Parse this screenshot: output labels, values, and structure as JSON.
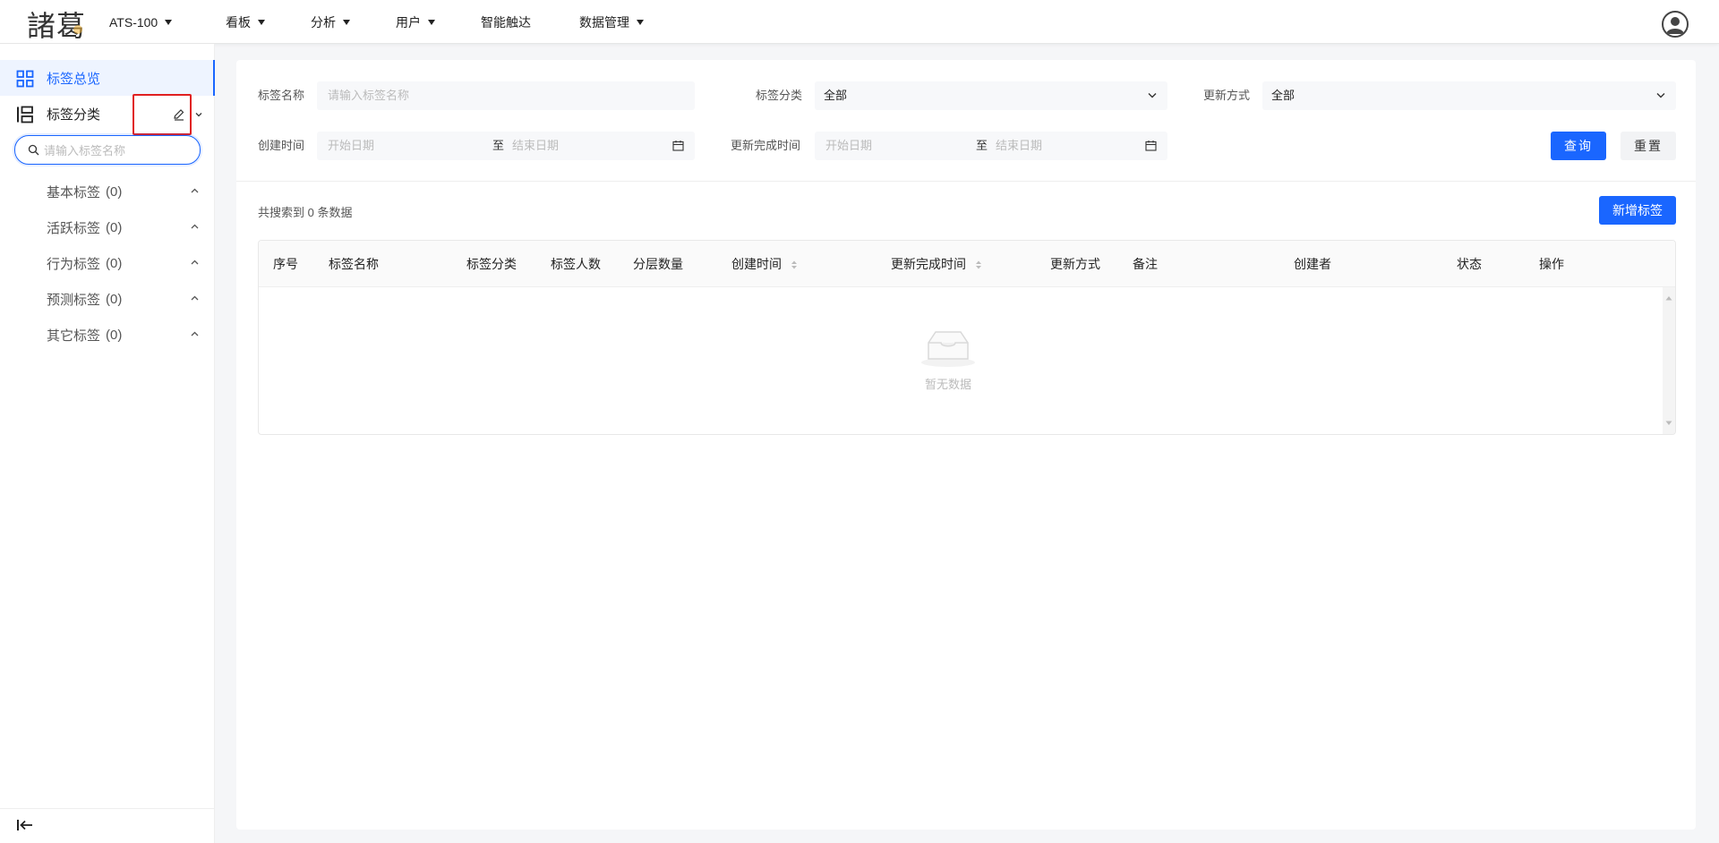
{
  "logo": {
    "text": "諸葛"
  },
  "topnav": [
    {
      "label": "ATS-100",
      "dropdown": true
    },
    {
      "label": "看板",
      "dropdown": true
    },
    {
      "label": "分析",
      "dropdown": true
    },
    {
      "label": "用户",
      "dropdown": true
    },
    {
      "label": "智能触达",
      "dropdown": false
    },
    {
      "label": "数据管理",
      "dropdown": true
    }
  ],
  "sidebar": {
    "overview_label": "标签总览",
    "category_label": "标签分类",
    "search_placeholder": "请输入标签名称",
    "tree": [
      {
        "label": "基本标签",
        "count": "(0)"
      },
      {
        "label": "活跃标签",
        "count": "(0)"
      },
      {
        "label": "行为标签",
        "count": "(0)"
      },
      {
        "label": "预测标签",
        "count": "(0)"
      },
      {
        "label": "其它标签",
        "count": "(0)"
      }
    ]
  },
  "filters": {
    "name_label": "标签名称",
    "name_placeholder": "请输入标签名称",
    "category_label": "标签分类",
    "category_value": "全部",
    "update_mode_label": "更新方式",
    "update_mode_value": "全部",
    "created_label": "创建时间",
    "completed_label": "更新完成时间",
    "start_placeholder": "开始日期",
    "end_placeholder": "结束日期",
    "range_sep": "至",
    "query_button": "查询",
    "reset_button": "重置"
  },
  "results": {
    "count_text": "共搜索到 0 条数据",
    "add_button": "新增标签"
  },
  "table": {
    "columns": [
      "序号",
      "标签名称",
      "标签分类",
      "标签人数",
      "分层数量",
      "创建时间",
      "更新完成时间",
      "更新方式",
      "备注",
      "创建者",
      "状态",
      "操作"
    ],
    "empty_text": "暂无数据"
  },
  "colors": {
    "primary": "#1a66ff",
    "highlight_box": "#e02020"
  }
}
